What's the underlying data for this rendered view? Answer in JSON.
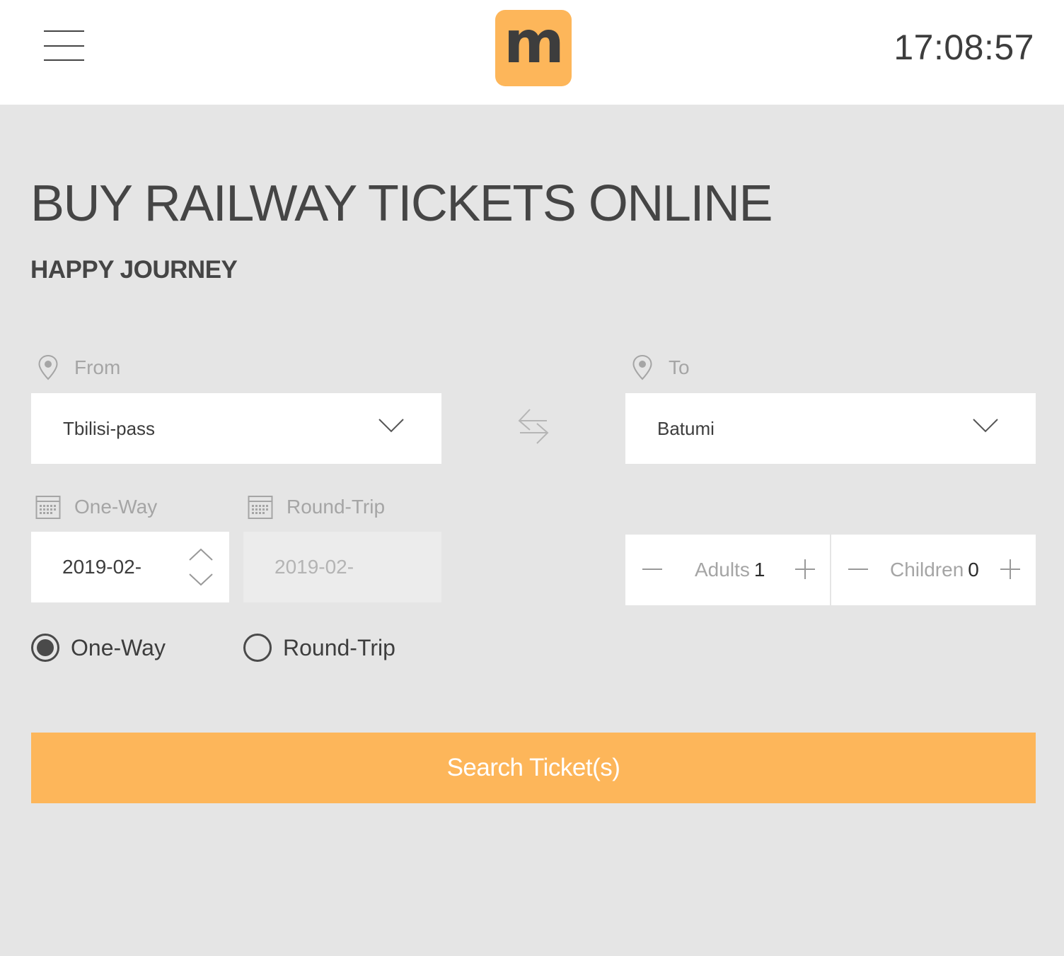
{
  "header": {
    "logo_letter": "m",
    "clock": "17:08:57"
  },
  "hero": {
    "title": "BUY RAILWAY TICKETS ONLINE",
    "subtitle": "HAPPY JOURNEY"
  },
  "form": {
    "from": {
      "label": "From",
      "value": "Tbilisi-pass",
      "icon": "location-pin-icon"
    },
    "to": {
      "label": "To",
      "value": "Batumi",
      "icon": "location-pin-icon"
    },
    "one_way_date": {
      "label": "One-Way",
      "value": "2019-02-",
      "icon": "calendar-icon"
    },
    "round_trip_date": {
      "label": "Round-Trip",
      "value": "2019-02-",
      "icon": "calendar-icon",
      "disabled": true
    },
    "adults": {
      "label": "Adults",
      "value": "1"
    },
    "children": {
      "label": "Children",
      "value": "0"
    },
    "trip_type": {
      "options": [
        {
          "label": "One-Way",
          "selected": true
        },
        {
          "label": "Round-Trip",
          "selected": false
        }
      ]
    },
    "search_label": "Search Ticket(s)"
  },
  "colors": {
    "accent": "#fdb65a",
    "background": "#e5e5e5",
    "text": "#454545",
    "muted": "#a5a5a5"
  }
}
